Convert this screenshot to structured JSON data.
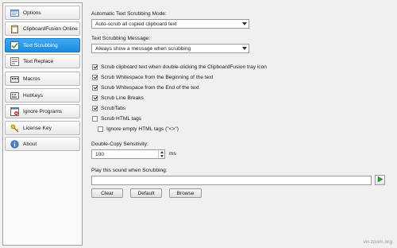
{
  "sidebar": {
    "items": [
      {
        "label": "Options",
        "icon": "options-icon",
        "selected": false
      },
      {
        "label": "ClipboardFusion Online",
        "icon": "clipboard-icon",
        "selected": false
      },
      {
        "label": "Text Scrubbing",
        "icon": "scrub-checklist-icon",
        "selected": true
      },
      {
        "label": "Text Replace",
        "icon": "text-replace-icon",
        "selected": false
      },
      {
        "label": "Macros",
        "icon": "macros-icon",
        "selected": false
      },
      {
        "label": "HotKeys",
        "icon": "hotkeys-icon",
        "selected": false
      },
      {
        "label": "Ignore Programs",
        "icon": "ignore-programs-icon",
        "selected": false
      },
      {
        "label": "License Key",
        "icon": "key-icon",
        "selected": false
      },
      {
        "label": "About",
        "icon": "about-icon",
        "selected": false
      }
    ]
  },
  "main": {
    "auto_mode_label": "Automatic Text Scrubbing Mode:",
    "auto_mode_value": "Auto-scrub all copied clipboard text",
    "message_label": "Text Scrubbing Message:",
    "message_value": "Always show a message when scrubbing",
    "checkboxes": [
      {
        "label": "Scrub clipboard text when double-clicking the ClipboardFusion tray icon",
        "checked": true
      },
      {
        "label": "Scrub Whitespace from the Beginning of the text",
        "checked": true
      },
      {
        "label": "Scrub Whitespace from the End of the text",
        "checked": true
      },
      {
        "label": "Scrub Line Breaks",
        "checked": true
      },
      {
        "label": "ScrubTabs",
        "checked": true
      },
      {
        "label": "Scrub HTML tags",
        "checked": false
      },
      {
        "label": "Ignore empty HTML tags (\"<>\")",
        "checked": false
      }
    ],
    "double_copy_label": "Double-Copy Sensitivity:",
    "double_copy_value": "100",
    "double_copy_unit": "ms",
    "sound_label": "Play this sound when Scrubbing:",
    "sound_value": "",
    "buttons": {
      "clear": "Clear",
      "default": "Default",
      "browse": "Browse"
    }
  },
  "watermark": "vn-zoom.org",
  "colors": {
    "selected_bg": "#1a8ce0",
    "play_green": "#2e9e2e"
  }
}
